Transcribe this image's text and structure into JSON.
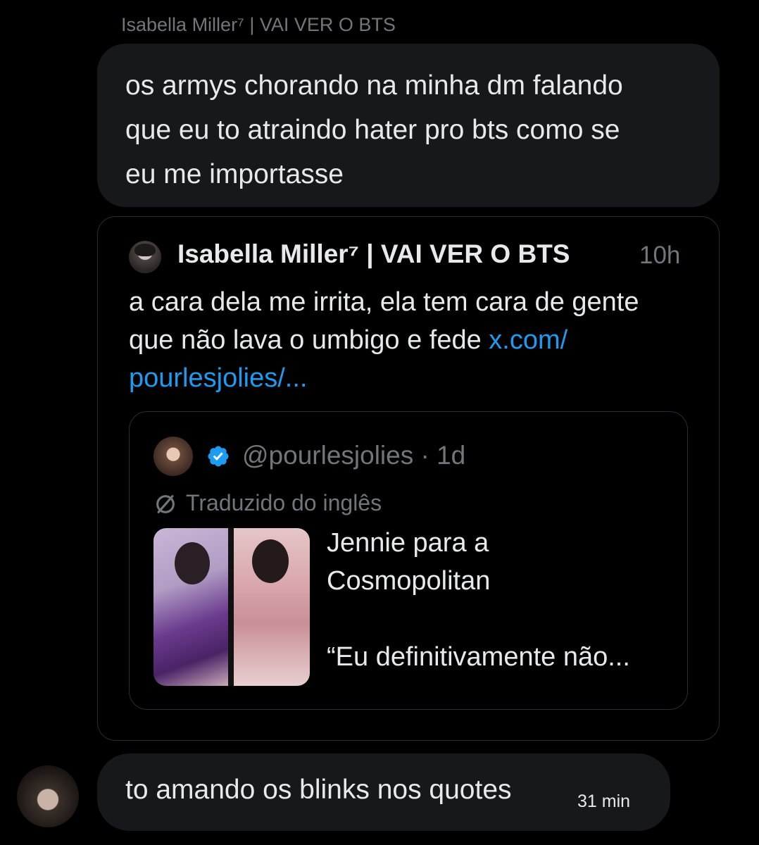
{
  "conversation": {
    "sender_name": "Isabella Miller⁷ | VAI VER O BTS",
    "received_message": {
      "lines": [
        "os armys chorando na minha dm falando",
        "que eu to atraindo hater pro bts como se",
        "eu me importasse"
      ]
    },
    "quoted_post": {
      "author_name": "Isabella Miller⁷ | VAI VER O BTS",
      "time": "10h",
      "text_line1": "a cara dela me irrita, ela tem cara de gente",
      "text_line2_plain": "que não lava o umbigo e fede ",
      "text_line2_link": "x.com/",
      "text_line3_link": "pourlesjolies/...",
      "nested_post": {
        "handle_and_time": "@pourlesjolies · 1d",
        "translated_label": "Traduzido do inglês",
        "text_line1": "Jennie para a",
        "text_line2": "Cosmopolitan",
        "text_line3": "“Eu definitivamente não..."
      }
    },
    "sent_message": {
      "text": "to amando os blinks nos quotes",
      "time": "31 min"
    }
  },
  "colors": {
    "background": "#000000",
    "bubble": "#16181c",
    "text": "#e7e9ea",
    "muted": "#71767b",
    "link": "#1d9bf0",
    "verified": "#1d9bf0"
  },
  "icons": [
    "verified-badge-icon",
    "translate-icon"
  ]
}
